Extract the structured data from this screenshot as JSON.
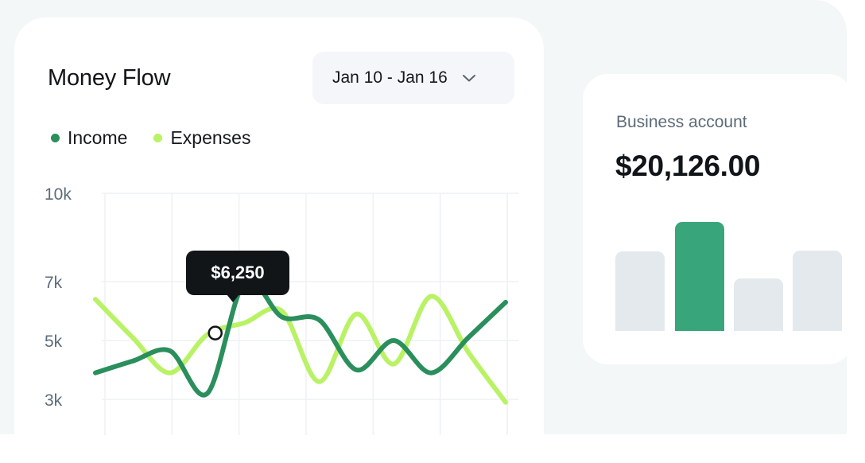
{
  "money_flow": {
    "title": "Money Flow",
    "date_range": "Jan 10 - Jan 16",
    "legend": [
      {
        "label": "Income",
        "color": "#2a8f5c"
      },
      {
        "label": "Expenses",
        "color": "#b9f265"
      }
    ],
    "tooltip": "$6,250"
  },
  "chart_data": {
    "type": "line",
    "y_ticks": [
      "10k",
      "7k",
      "5k",
      "3k"
    ],
    "y_tick_values": [
      10000,
      7000,
      5000,
      3000
    ],
    "grid": true,
    "series": [
      {
        "name": "Income",
        "color": "#2a8f5c",
        "values": [
          3900,
          4300,
          4650,
          3200,
          7000,
          5800,
          5700,
          4000,
          5000,
          3900,
          5100,
          6300
        ]
      },
      {
        "name": "Expenses",
        "color": "#b9f265",
        "values": [
          6400,
          5100,
          3900,
          5200,
          5600,
          6000,
          3600,
          5900,
          4200,
          6500,
          4600,
          2900
        ]
      }
    ],
    "highlight": {
      "series": "Expenses",
      "index": 3,
      "label": "$6,250"
    }
  },
  "account": {
    "label": "Business account",
    "balance": "$20,126.00",
    "bars": [
      {
        "value": 0.73,
        "color": "#e3e9ed"
      },
      {
        "value": 1.0,
        "color": "#38a67a"
      },
      {
        "value": 0.48,
        "color": "#e3e9ed"
      },
      {
        "value": 0.74,
        "color": "#e3e9ed"
      }
    ]
  }
}
